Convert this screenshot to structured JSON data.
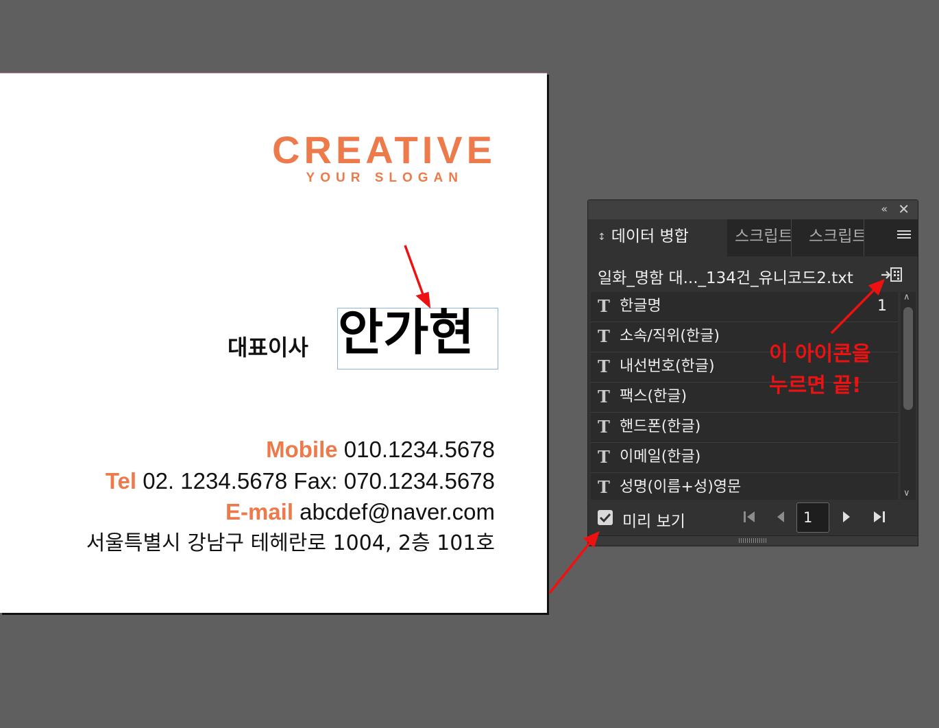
{
  "card": {
    "logo": "CREATIVE",
    "slogan": "YOUR SLOGAN",
    "role": "대표이사",
    "name": "안가현",
    "mobile_label": "Mobile",
    "mobile": "010.1234.5678",
    "tel_label": "Tel",
    "tel_fax": "02. 1234.5678 Fax: 070.1234.5678",
    "email_label": "E-mail",
    "email": "abcdef@naver.com",
    "address": "서울특별시 강남구 테헤란로 1004, 2층 101호",
    "accent_color": "#ec7a4a"
  },
  "panel": {
    "tabs": [
      "데이터 병합",
      "스크립트",
      "스크립트"
    ],
    "source_file": "일화_명함   대..._134건_유니코드2.txt",
    "fields": [
      {
        "name": "한글명",
        "value": "1"
      },
      {
        "name": "소속/직위(한글)",
        "value": ""
      },
      {
        "name": "내선번호(한글)",
        "value": ""
      },
      {
        "name": "팩스(한글)",
        "value": ""
      },
      {
        "name": "핸드폰(한글)",
        "value": ""
      },
      {
        "name": "이메일(한글)",
        "value": ""
      },
      {
        "name": "성명(이름+성)영문",
        "value": ""
      }
    ],
    "preview_label": "미리 보기",
    "preview_checked": true,
    "record": "1",
    "icons": {
      "collapse": "double-chevron-left-icon",
      "close": "close-icon",
      "menu": "hamburger-menu-icon",
      "merge": "create-merged-document-icon",
      "field": "text-field-icon"
    }
  },
  "annotation": {
    "line1": "이 아이콘을",
    "line2": "누르면 끝!",
    "color": "#ee1111"
  }
}
